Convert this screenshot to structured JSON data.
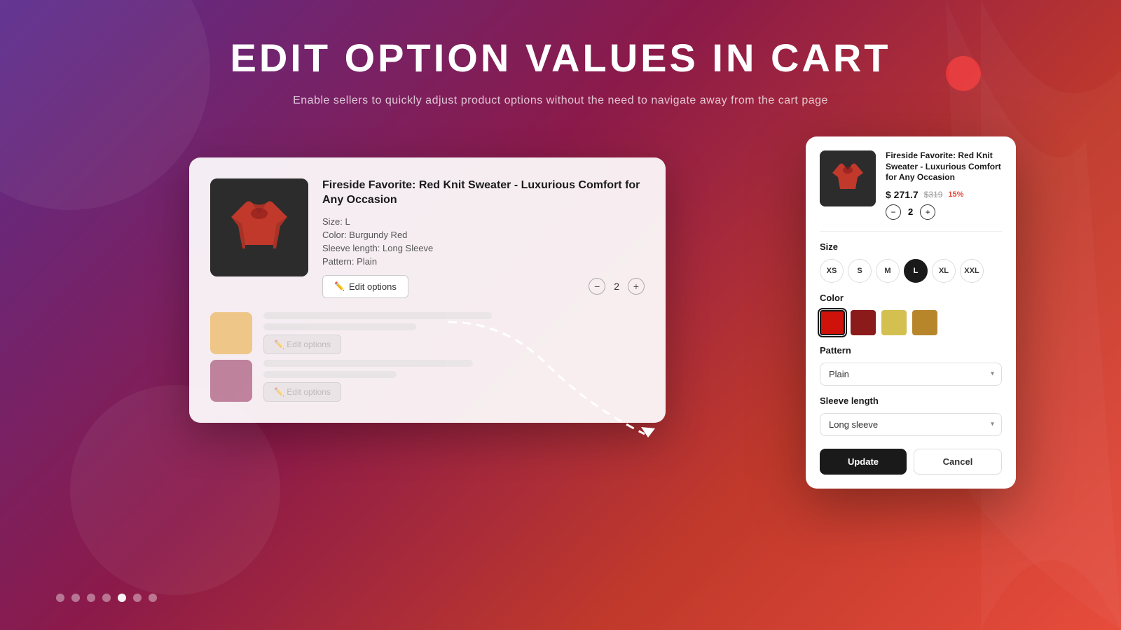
{
  "page": {
    "title": "EDIT OPTION VALUES IN CART",
    "subtitle": "Enable sellers to quickly adjust product options without the need to navigate away from the cart page"
  },
  "cart": {
    "item": {
      "title": "Fireside Favorite: Red Knit Sweater - Luxurious Comfort for Any Occasion",
      "size": "Size: L",
      "color": "Color: Burgundy Red",
      "sleeve": "Sleeve length: Long Sleeve",
      "pattern": "Pattern: Plain",
      "qty": "2",
      "edit_button": "Edit options"
    }
  },
  "modal": {
    "product_title": "Fireside Favorite: Red Knit Sweater - Luxurious Comfort for Any Occasion",
    "price": "$ 271.7",
    "original_price": "$319",
    "discount": "15%",
    "qty": "2",
    "size_label": "Size",
    "sizes": [
      "XS",
      "S",
      "M",
      "L",
      "XL",
      "XXL"
    ],
    "active_size": "L",
    "color_label": "Color",
    "colors": [
      "#d0130a",
      "#8b1a1a",
      "#d4c050",
      "#b8862a"
    ],
    "active_color_index": 0,
    "pattern_label": "Pattern",
    "pattern_value": "Plain",
    "sleeve_label": "Sleeve length",
    "sleeve_value": "Long sleeve",
    "update_button": "Update",
    "cancel_button": "Cancel"
  },
  "pagination": {
    "total": 7,
    "active": 4
  }
}
